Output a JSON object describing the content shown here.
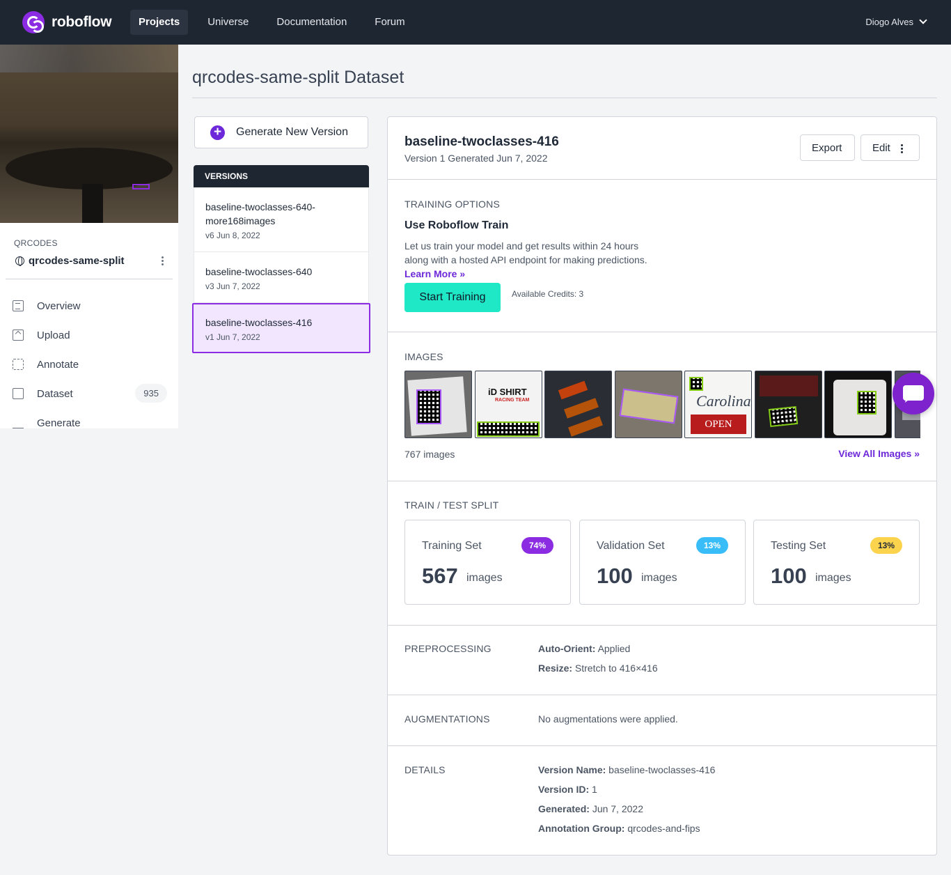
{
  "nav": {
    "brand": "roboflow",
    "links": [
      "Projects",
      "Universe",
      "Documentation",
      "Forum"
    ],
    "user": "Diogo Alves"
  },
  "sidebar": {
    "project_type": "QRCODES",
    "project_name": "qrcodes-same-split",
    "items": [
      {
        "label": "Overview",
        "icon": "book-icon"
      },
      {
        "label": "Upload",
        "icon": "upload-icon"
      },
      {
        "label": "Annotate",
        "icon": "annotate-icon"
      },
      {
        "label": "Dataset",
        "icon": "images-icon",
        "count": "935"
      },
      {
        "label": "Generate",
        "icon": "layers-plus-icon"
      }
    ]
  },
  "page": {
    "title": "qrcodes-same-split Dataset",
    "generate_button": "Generate New Version"
  },
  "versions": {
    "header": "VERSIONS",
    "items": [
      {
        "name": "baseline-twoclasses-640-more168images",
        "meta": "v6 Jun 8, 2022"
      },
      {
        "name": "baseline-twoclasses-640",
        "meta": "v3 Jun 7, 2022"
      },
      {
        "name": "baseline-twoclasses-416",
        "meta": "v1 Jun 7, 2022",
        "selected": true
      }
    ]
  },
  "detail": {
    "name": "baseline-twoclasses-416",
    "subtitle": "Version 1 Generated Jun 7, 2022",
    "export_label": "Export",
    "edit_label": "Edit",
    "training": {
      "label": "TRAINING OPTIONS",
      "title": "Use Roboflow Train",
      "description": "Let us train your model and get results within 24 hours along with a hosted API endpoint for making predictions.",
      "learn_more": "Learn More »",
      "start_button": "Start Training",
      "credits": "Available Credits: 3"
    },
    "images": {
      "label": "IMAGES",
      "count": "767 images",
      "view_all": "View All Images »",
      "thumbnail_count": 8
    },
    "split": {
      "label": "TRAIN / TEST SPLIT",
      "sets": [
        {
          "name": "Training Set",
          "pct": "74%",
          "count": "567",
          "unit": "images",
          "color": "#8b2be2"
        },
        {
          "name": "Validation Set",
          "pct": "13%",
          "count": "100",
          "unit": "images",
          "color": "#38bdf8"
        },
        {
          "name": "Testing Set",
          "pct": "13%",
          "count": "100",
          "unit": "images",
          "color": "#fcd34d"
        }
      ]
    },
    "preprocessing": {
      "label": "PREPROCESSING",
      "items": [
        {
          "key": "Auto-Orient:",
          "value": "Applied"
        },
        {
          "key": "Resize:",
          "value": "Stretch to 416×416"
        }
      ]
    },
    "augmentations": {
      "label": "AUGMENTATIONS",
      "value": "No augmentations were applied."
    },
    "details": {
      "label": "DETAILS",
      "items": [
        {
          "key": "Version Name:",
          "value": "baseline-twoclasses-416"
        },
        {
          "key": "Version ID:",
          "value": "1"
        },
        {
          "key": "Generated:",
          "value": "Jun 7, 2022"
        },
        {
          "key": "Annotation Group:",
          "value": "qrcodes-and-fips"
        }
      ]
    }
  }
}
